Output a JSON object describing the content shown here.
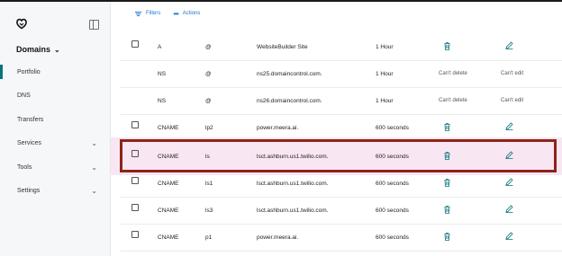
{
  "sidebar": {
    "domains_label": "Domains",
    "items": [
      {
        "label": "Portfolio",
        "has_chevron": false,
        "active": true
      },
      {
        "label": "DNS",
        "has_chevron": false,
        "active": false
      },
      {
        "label": "Transfers",
        "has_chevron": false,
        "active": false
      },
      {
        "label": "Services",
        "has_chevron": true,
        "active": false
      },
      {
        "label": "Tools",
        "has_chevron": true,
        "active": false
      },
      {
        "label": "Settings",
        "has_chevron": true,
        "active": false
      }
    ]
  },
  "toolbar": {
    "filters_label": "Filters",
    "actions_label": "Actions"
  },
  "records": [
    {
      "type": "A",
      "name": "@",
      "value": "WebsiteBuilder Site",
      "ttl": "1 Hour",
      "delete": "",
      "edit": ""
    },
    {
      "type": "NS",
      "name": "@",
      "value": "ns25.domaincontrol.com.",
      "ttl": "1 Hour",
      "delete": "Can't delete",
      "edit": "Can't edit"
    },
    {
      "type": "NS",
      "name": "@",
      "value": "ns26.domaincontrol.com.",
      "ttl": "1 Hour",
      "delete": "Can't delete",
      "edit": "Can't edit"
    },
    {
      "type": "CNAME",
      "name": "lp2",
      "value": "power.meera.ai.",
      "ttl": "600 seconds",
      "delete": "",
      "edit": ""
    },
    {
      "type": "CNAME",
      "name": "ls",
      "value": "lsct.ashburn.us1.twilio.com.",
      "ttl": "600 seconds",
      "delete": "",
      "edit": ""
    },
    {
      "type": "CNAME",
      "name": "ls1",
      "value": "lsct.ashburn.us1.twilio.com.",
      "ttl": "600 seconds",
      "delete": "",
      "edit": ""
    },
    {
      "type": "CNAME",
      "name": "ls3",
      "value": "lsct.ashburn.us1.twilio.com.",
      "ttl": "600 seconds",
      "delete": "",
      "edit": ""
    },
    {
      "type": "CNAME",
      "name": "p1",
      "value": "power.meera.ai.",
      "ttl": "600 seconds",
      "delete": "",
      "edit": ""
    }
  ],
  "colors": {
    "accent_blue": "#1976d2",
    "active_nav": "#09757a",
    "highlight_frame": "#8d2418",
    "highlight_band": "#f8e6f2"
  }
}
